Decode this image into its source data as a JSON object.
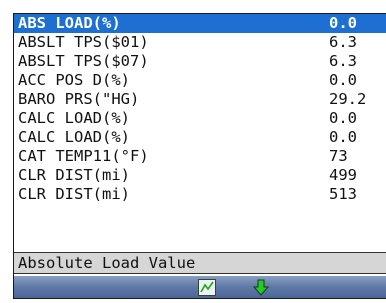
{
  "pid_list": {
    "items": [
      {
        "label": "ABS LOAD(%)",
        "value": "0.0",
        "selected": true
      },
      {
        "label": "ABSLT TPS($01)",
        "value": "6.3"
      },
      {
        "label": "ABSLT TPS($07)",
        "value": "6.3"
      },
      {
        "label": "ACC POS D(%)",
        "value": "0.0"
      },
      {
        "label": "BARO PRS(\"HG)",
        "value": "29.2"
      },
      {
        "label": "CALC LOAD(%)",
        "value": "0.0"
      },
      {
        "label": "CALC LOAD(%)",
        "value": "0.0"
      },
      {
        "label": "CAT TEMP11(°F)",
        "value": "73"
      },
      {
        "label": "CLR DIST(mi)",
        "value": "499"
      },
      {
        "label": "CLR DIST(mi)",
        "value": "513"
      }
    ]
  },
  "description": {
    "text": "Absolute Load Value"
  },
  "toolbar": {
    "icons": [
      "graph-icon",
      "down-arrow-icon"
    ],
    "colors": {
      "graph_line": "#19a819",
      "arrow": "#22cc22",
      "bar": "#5e78a6"
    }
  },
  "colors": {
    "selection": "#1d6fd1"
  }
}
